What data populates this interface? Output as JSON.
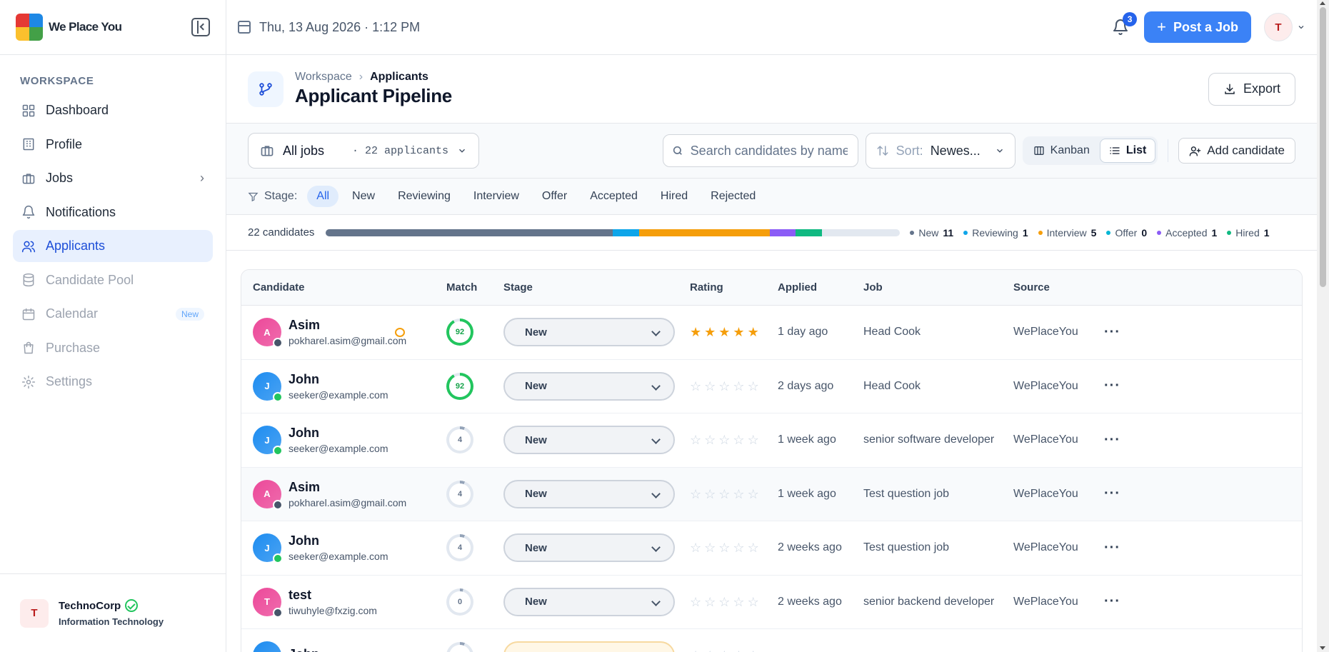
{
  "brand": {
    "name": "We Place You"
  },
  "sidebar": {
    "section": "WORKSPACE",
    "items": [
      {
        "label": "Dashboard",
        "icon": "grid-icon",
        "state": "normal"
      },
      {
        "label": "Profile",
        "icon": "building-icon",
        "state": "normal"
      },
      {
        "label": "Jobs",
        "icon": "briefcase-icon",
        "state": "normal",
        "chevron": true
      },
      {
        "label": "Notifications",
        "icon": "bell-icon",
        "state": "normal"
      },
      {
        "label": "Applicants",
        "icon": "users-icon",
        "state": "active"
      },
      {
        "label": "Candidate Pool",
        "icon": "database-icon",
        "state": "disabled"
      },
      {
        "label": "Calendar",
        "icon": "calendar-icon",
        "state": "disabled",
        "badge": "New"
      },
      {
        "label": "Purchase",
        "icon": "bag-icon",
        "state": "disabled"
      },
      {
        "label": "Settings",
        "icon": "gear-icon",
        "state": "disabled"
      }
    ],
    "org": {
      "initial": "T",
      "name": "TechnoCorp",
      "industry": "Information Technology"
    }
  },
  "topbar": {
    "datetime": "Thu, 13 Aug 2026 · 1:12 PM",
    "notification_count": "3",
    "post_job": "Post a Job",
    "user_initial": "T"
  },
  "header": {
    "breadcrumb_root": "Workspace",
    "breadcrumb_current": "Applicants",
    "title": "Applicant Pipeline",
    "export": "Export"
  },
  "toolbar": {
    "jobs_filter": "All jobs",
    "applicants_count": "· 22 applicants",
    "search_placeholder": "Search candidates by name...",
    "sort_label": "Sort:",
    "sort_value": "Newes...",
    "view_kanban": "Kanban",
    "view_list": "List",
    "add_candidate": "Add candidate"
  },
  "stages": {
    "label": "Stage:",
    "options": [
      "All",
      "New",
      "Reviewing",
      "Interview",
      "Offer",
      "Accepted",
      "Hired",
      "Rejected"
    ],
    "selected": "All"
  },
  "progress": {
    "total_label": "22 candidates",
    "total": 22,
    "segments": [
      {
        "name": "New",
        "count": 11,
        "color": "#64748b"
      },
      {
        "name": "Reviewing",
        "count": 1,
        "color": "#0ea5e9"
      },
      {
        "name": "Interview",
        "count": 5,
        "color": "#f59e0b"
      },
      {
        "name": "Offer",
        "count": 0,
        "color": "#06b6d4"
      },
      {
        "name": "Accepted",
        "count": 1,
        "color": "#8b5cf6"
      },
      {
        "name": "Hired",
        "count": 1,
        "color": "#10b981"
      }
    ]
  },
  "table": {
    "columns": [
      "Candidate",
      "Match",
      "Stage",
      "Rating",
      "Applied",
      "Job",
      "Source"
    ],
    "rows": [
      {
        "initial": "A",
        "name": "Asim",
        "email": "pokharel.asim@gmail.com",
        "avatar_color": "#ec4899",
        "status_color": "#475569",
        "chat": true,
        "match": 92,
        "match_label": "92",
        "stage": "New",
        "rating": 5,
        "applied": "1 day ago",
        "job": "Head Cook",
        "source": "WePlaceYou"
      },
      {
        "initial": "J",
        "name": "John",
        "email": "seeker@example.com",
        "avatar_color": "#1d8cf0",
        "status_color": "#22c55e",
        "chat": false,
        "match": 92,
        "match_label": "92",
        "stage": "New",
        "rating": 0,
        "applied": "2 days ago",
        "job": "Head Cook",
        "source": "WePlaceYou"
      },
      {
        "initial": "J",
        "name": "John",
        "email": "seeker@example.com",
        "avatar_color": "#1d8cf0",
        "status_color": "#22c55e",
        "chat": false,
        "match": 4,
        "match_label": "4",
        "stage": "New",
        "rating": 0,
        "applied": "1 week ago",
        "job": "senior software developer",
        "source": "WePlaceYou"
      },
      {
        "initial": "A",
        "name": "Asim",
        "email": "pokharel.asim@gmail.com",
        "avatar_color": "#ec4899",
        "status_color": "#475569",
        "chat": false,
        "match": 4,
        "match_label": "4",
        "stage": "New",
        "rating": 0,
        "applied": "1 week ago",
        "job": "Test question job",
        "source": "WePlaceYou",
        "hover": true
      },
      {
        "initial": "J",
        "name": "John",
        "email": "seeker@example.com",
        "avatar_color": "#1d8cf0",
        "status_color": "#22c55e",
        "chat": false,
        "match": 4,
        "match_label": "4",
        "stage": "New",
        "rating": 0,
        "applied": "2 weeks ago",
        "job": "Test question job",
        "source": "WePlaceYou"
      },
      {
        "initial": "T",
        "name": "test",
        "email": "tiwuhyle@fxzig.com",
        "avatar_color": "#ec4899",
        "status_color": "#475569",
        "chat": false,
        "match": 0,
        "match_label": "0",
        "stage": "New",
        "rating": 0,
        "applied": "2 weeks ago",
        "job": "senior backend developer",
        "source": "WePlaceYou"
      },
      {
        "initial": "J",
        "name": "John",
        "email": "",
        "avatar_color": "#1d8cf0",
        "status_color": "#22c55e",
        "chat": false,
        "match": 4,
        "match_label": "",
        "stage": "",
        "stage_style": "warn",
        "rating": 0,
        "applied": "",
        "job": "",
        "source": ""
      }
    ]
  }
}
